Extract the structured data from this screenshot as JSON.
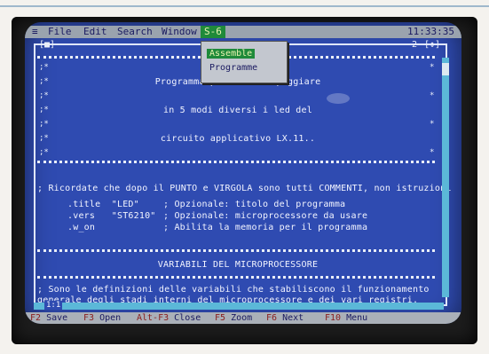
{
  "menubar": {
    "items": [
      {
        "label": "File"
      },
      {
        "label": "Edit"
      },
      {
        "label": "Search"
      },
      {
        "label": "Window"
      },
      {
        "label": "S-6"
      }
    ],
    "clock": "11:33:35"
  },
  "dropdown": {
    "items": [
      {
        "label": "Assemble",
        "selected": true
      },
      {
        "label": "Programme",
        "selected": false
      }
    ]
  },
  "window": {
    "number_left": "1",
    "number_right": "2",
    "intro_lines": [
      "Programma per fare lampeggiare",
      "in 5 modi diversi i led del",
      "circuito applicativo LX.11.."
    ],
    "note": "; Ricordate che dopo il PUNTO e VIRGOLA sono tutti COMMENTI, non istruzioni",
    "code_lines": [
      {
        "code": ".title  \"LED\"",
        "comment": "; Opzionale: titolo del programma"
      },
      {
        "code": ".vers   \"ST6210\"",
        "comment": "; Opzionale: microprocessore da usare"
      },
      {
        "code": ".w_on",
        "comment": "; Abilita la memoria per il programma"
      }
    ],
    "section_title": "VARIABILI DEL MICROPROCESSORE",
    "section_lines": [
      "; Sono le definizioni delle variabili che stabiliscono il funzionamento",
      "generale degli stadi interni del microprocessore e dei vari registri."
    ],
    "position": "1:1"
  },
  "statusbar": {
    "items": [
      {
        "key": "F2",
        "label": "Save"
      },
      {
        "key": "F3",
        "label": "Open"
      },
      {
        "key": "Alt-F3",
        "label": "Close"
      },
      {
        "key": "F5",
        "label": "Zoom"
      },
      {
        "key": "F6",
        "label": "Next"
      },
      {
        "key": "F10",
        "label": "Menu"
      }
    ]
  }
}
